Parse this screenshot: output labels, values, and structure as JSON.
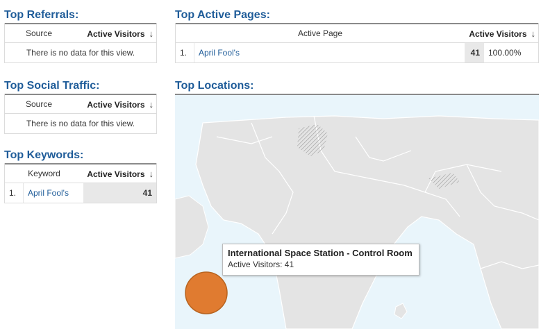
{
  "referrals": {
    "title": "Top Referrals:",
    "col_dimension": "Source",
    "col_metric": "Active Visitors",
    "empty_text": "There is no data for this view."
  },
  "social": {
    "title": "Top Social Traffic:",
    "col_dimension": "Source",
    "col_metric": "Active Visitors",
    "empty_text": "There is no data for this view."
  },
  "keywords": {
    "title": "Top Keywords:",
    "col_dimension": "Keyword",
    "col_metric": "Active Visitors",
    "rows": [
      {
        "rank": "1.",
        "name": "April Fool's",
        "value": "41"
      }
    ]
  },
  "pages": {
    "title": "Top Active Pages:",
    "col_dimension": "Active Page",
    "col_metric": "Active Visitors",
    "rows": [
      {
        "rank": "1.",
        "name": "April Fool's",
        "value": "41",
        "percent": "100.00%"
      }
    ]
  },
  "locations": {
    "title": "Top Locations:",
    "tooltip_title": "International Space Station - Control Room",
    "tooltip_value": "Active Visitors: 41",
    "marker_color": "#e07b30"
  },
  "icons": {
    "sort": "arrow-down-icon"
  },
  "colors": {
    "title": "#1f5c99",
    "link": "#1f5c99",
    "map_water": "#e9f5fb",
    "map_land": "#e4e4e4"
  }
}
